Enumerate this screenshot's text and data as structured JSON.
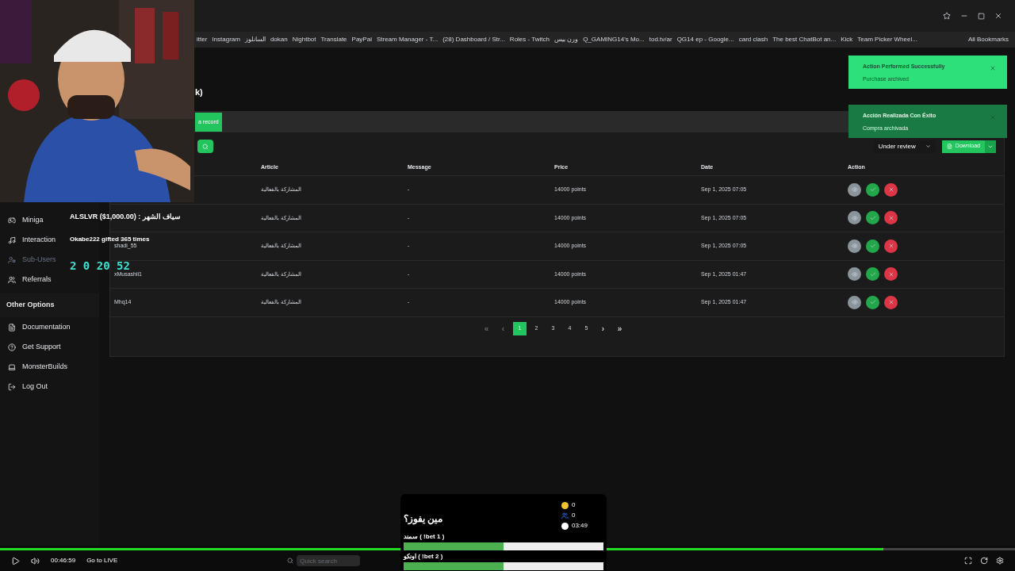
{
  "bookmarks": [
    "itter",
    "Instagram",
    "السانلوز",
    "dokan",
    "Nightbot",
    "Translate",
    "PayPal",
    "Stream Manager - T...",
    "(28) Dashboard / Str...",
    "Roles - Twitch",
    "ورن بيس",
    "Q_GAMING14's Mo...",
    "tod.tv/ar",
    "QG14 ep - Google...",
    "card clash",
    "The best ChatBot an...",
    "Kick",
    "Team Picker Wheel..."
  ],
  "all_bookmarks": "All Bookmarks",
  "sidebar": {
    "items": [
      {
        "label": "Miniga",
        "disabled": false
      },
      {
        "label": "Interaction",
        "disabled": false
      },
      {
        "label": "Sub-Users",
        "disabled": true
      },
      {
        "label": "Referrals",
        "disabled": false
      }
    ],
    "section": "Other Options",
    "other_items": [
      {
        "label": "Documentation"
      },
      {
        "label": "Get Support"
      },
      {
        "label": "MonsterBuilds"
      },
      {
        "label": "Log Out"
      }
    ]
  },
  "page_title": "k)",
  "add_button": "a record",
  "filter": {
    "value": "Under review"
  },
  "download_button": "Download",
  "toasts": [
    {
      "title": "Action Performed Successfully",
      "message": "Purchase archived",
      "dimmed": false
    },
    {
      "title": "Acción Realizada Con Éxito",
      "message": "Compra archivada",
      "dimmed": true
    }
  ],
  "table": {
    "columns": [
      "Article",
      "Message",
      "Price",
      "Date",
      "Action"
    ],
    "rows": [
      {
        "article": "المشاركة بالفعالية",
        "message": "-",
        "price": "14000 points",
        "date": "Sep 1, 2025 07:05"
      },
      {
        "article": "المشاركة بالفعالية",
        "message": "-",
        "price": "14000 points",
        "date": "Sep 1, 2025 07:05"
      },
      {
        "user": "shadi_55",
        "article": "المشاركة بالفعالية",
        "message": "-",
        "price": "14000 points",
        "date": "Sep 1, 2025 07:05"
      },
      {
        "user": "xMusashii1",
        "article": "المشاركة بالفعالية",
        "message": "-",
        "price": "14000 points",
        "date": "Sep 1, 2025 01:47"
      },
      {
        "user": "Mhq14",
        "article": "المشاركة بالفعالية",
        "message": "-",
        "price": "14000 points",
        "date": "Sep 1, 2025 01:47"
      }
    ]
  },
  "pagination": [
    {
      "label": "«",
      "kind": "nav",
      "disabled": true,
      "selected": false
    },
    {
      "label": "‹",
      "kind": "nav",
      "disabled": true,
      "selected": false
    },
    {
      "label": "1",
      "kind": "page",
      "disabled": false,
      "selected": true
    },
    {
      "label": "2",
      "kind": "page",
      "disabled": false,
      "selected": false
    },
    {
      "label": "3",
      "kind": "page",
      "disabled": false,
      "selected": false
    },
    {
      "label": "4",
      "kind": "page",
      "disabled": false,
      "selected": false
    },
    {
      "label": "5",
      "kind": "page",
      "disabled": false,
      "selected": false
    },
    {
      "label": "›",
      "kind": "nav",
      "disabled": false,
      "selected": false
    },
    {
      "label": "»",
      "kind": "nav",
      "disabled": false,
      "selected": false
    }
  ],
  "stream_overlay": {
    "top_donor": "ALSLVR ($1,000.00) : سياف الشهر",
    "gift": "Okabe222 gifted 365 times",
    "timer": "2 0 20 52"
  },
  "poll": {
    "question": "مين يفوز؟",
    "coins": "0",
    "viewers": "0",
    "time": "03:49",
    "options": [
      {
        "label": "سمند ( !bet 1 )",
        "level": 0.5
      },
      {
        "label": "اونكو ( !bet 2 )",
        "level": 0.5
      }
    ]
  },
  "player": {
    "progress": {
      "level": 0.87
    },
    "time": "00:46:59",
    "live_button": "Go to LIVE"
  },
  "taskbar": {
    "search": {
      "placeholder": "Quick search"
    }
  }
}
